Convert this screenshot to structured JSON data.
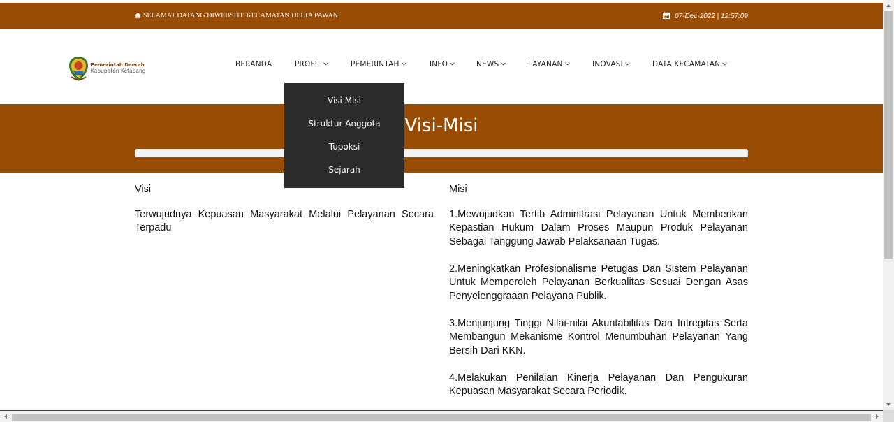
{
  "topbar": {
    "welcome": "SELAMAT DATANG DIWEBSITE KECAMATAN DELTA PAWAN",
    "datetime": "07-Dec-2022 | 12:57:09",
    "home_icon": "home-icon",
    "calendar_icon": "calendar-icon"
  },
  "logo": {
    "line1": "Pemerintah Daerah",
    "line2": "Kabupaten Ketapang"
  },
  "nav": {
    "items": [
      {
        "label": "BERANDA",
        "dropdown": false
      },
      {
        "label": "PROFIL",
        "dropdown": true
      },
      {
        "label": "PEMERINTAH",
        "dropdown": true
      },
      {
        "label": "INFO",
        "dropdown": true
      },
      {
        "label": "NEWS",
        "dropdown": true
      },
      {
        "label": "LAYANAN",
        "dropdown": true
      },
      {
        "label": "INOVASI",
        "dropdown": true
      },
      {
        "label": "DATA KECAMATAN",
        "dropdown": true
      }
    ]
  },
  "profil_dropdown": {
    "items": [
      "Visi Misi",
      "Struktur Anggota",
      "Tupoksi",
      "Sejarah"
    ]
  },
  "banner": {
    "title": "Visi-Misi"
  },
  "visi": {
    "heading": "Visi",
    "text": "Terwujudnya Kepuasan Masyarakat Melalui Pelayanan Secara Terpadu"
  },
  "misi": {
    "heading": "Misi",
    "items": [
      "1.Mewujudkan Tertib Adminitrasi Pelayanan Untuk Memberikan Kepastian Hukum Dalam Proses Maupun Produk Pelayanan Sebagai Tanggung Jawab Pelaksanaan Tugas.",
      "2.Meningkatkan Profesionalisme Petugas Dan Sistem Pelayanan Untuk Memperoleh Pelayanan Berkualitas Sesuai Dengan Asas Penyelenggraaan Pelayana Publik.",
      "3.Menjunjung Tinggi Nilai-nilai Akuntabilitas Dan Intregitas Serta Membangun Mekanisme Kontrol Menumbuhan Pelayanan Yang Bersih Dari KKN.",
      "4.Melakukan Penilaian Kinerja Pelayanan Dan Pengukuran Kepuasan Masyarakat Secara Periodik."
    ]
  },
  "colors": {
    "brand": "#994c03",
    "dropdown_bg": "#2b2b2b"
  }
}
